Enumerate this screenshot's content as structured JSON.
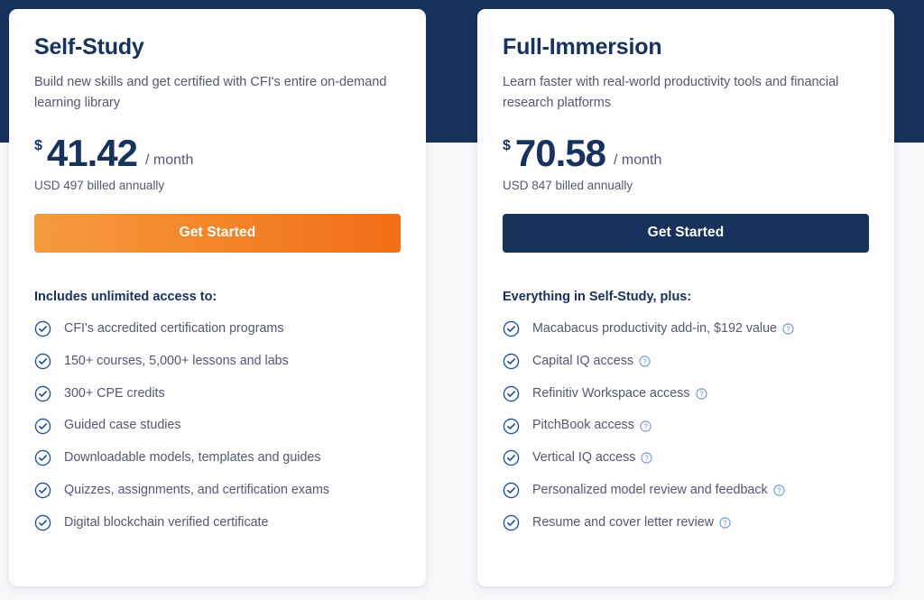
{
  "theme": {
    "navy": "#17325c",
    "orange_start": "#f59b3c",
    "orange_end": "#f26f16",
    "body_text": "#55596b",
    "page_background": "#f8f8fb",
    "card_background": "#fdfdfe"
  },
  "plans": [
    {
      "name": "Self-Study",
      "description": "Build new skills and get certified with CFI's entire on-demand learning library",
      "currency_symbol": "$",
      "price": "41.42",
      "period": "/ month",
      "billing_note": "USD 497 billed annually",
      "cta_label": "Get Started",
      "cta_style": "orange",
      "features_heading": "Includes unlimited access to:",
      "features": [
        {
          "label": "CFI's accredited certification programs",
          "help": false
        },
        {
          "label": "150+ courses, 5,000+ lessons and labs",
          "help": false
        },
        {
          "label": "300+ CPE credits",
          "help": false
        },
        {
          "label": "Guided case studies",
          "help": false
        },
        {
          "label": "Downloadable models, templates and guides",
          "help": false
        },
        {
          "label": "Quizzes, assignments, and certification exams",
          "help": false
        },
        {
          "label": "Digital blockchain verified certificate",
          "help": false
        }
      ]
    },
    {
      "name": "Full-Immersion",
      "description": "Learn faster with real-world productivity tools and financial research platforms",
      "currency_symbol": "$",
      "price": "70.58",
      "period": "/ month",
      "billing_note": "USD 847 billed annually",
      "cta_label": "Get Started",
      "cta_style": "navy",
      "features_heading": "Everything in Self-Study, plus:",
      "features": [
        {
          "label": "Macabacus productivity add-in, $192 value",
          "help": true
        },
        {
          "label": "Capital IQ access",
          "help": true
        },
        {
          "label": "Refinitiv Workspace access",
          "help": true
        },
        {
          "label": "PitchBook access",
          "help": true
        },
        {
          "label": "Vertical IQ access",
          "help": true
        },
        {
          "label": "Personalized model review and feedback",
          "help": true
        },
        {
          "label": "Resume and cover letter review",
          "help": true
        }
      ]
    }
  ],
  "icons": {
    "check": "check-circle-icon",
    "help": "help-circle-icon"
  }
}
